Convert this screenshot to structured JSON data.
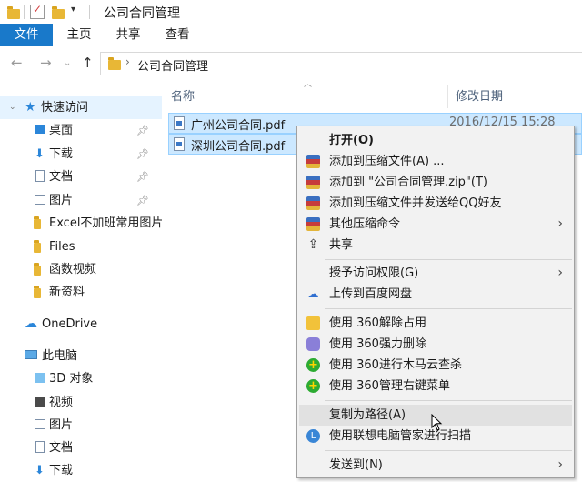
{
  "window": {
    "title": "公司合同管理"
  },
  "ribbon": {
    "tabs": [
      "文件",
      "主页",
      "共享",
      "查看"
    ]
  },
  "address": {
    "path": "公司合同管理"
  },
  "sidebar": {
    "quick_access": "快速访问",
    "items": [
      {
        "label": "桌面",
        "pinned": true
      },
      {
        "label": "下载",
        "pinned": true
      },
      {
        "label": "文档",
        "pinned": true
      },
      {
        "label": "图片",
        "pinned": true
      },
      {
        "label": "Excel不加班常用图片",
        "pinned": false
      },
      {
        "label": "Files",
        "pinned": false
      },
      {
        "label": "函数视频",
        "pinned": false
      },
      {
        "label": "新资料",
        "pinned": false
      }
    ],
    "onedrive": "OneDrive",
    "this_pc": "此电脑",
    "pc_items": [
      "3D 对象",
      "视频",
      "图片",
      "文档",
      "下载"
    ]
  },
  "columns": {
    "name": "名称",
    "date": "修改日期"
  },
  "files": [
    {
      "name": "广州公司合同.pdf",
      "date": "2016/12/15 15:28"
    },
    {
      "name": "深圳公司合同.pdf",
      "date": ""
    }
  ],
  "context_menu": {
    "items": [
      {
        "label": "打开(O)",
        "icon": "none",
        "bold": true
      },
      {
        "label": "添加到压缩文件(A) ...",
        "icon": "archive-icon"
      },
      {
        "label": "添加到 \"公司合同管理.zip\"(T)",
        "icon": "archive-icon"
      },
      {
        "label": "添加到压缩文件并发送给QQ好友",
        "icon": "archive-icon"
      },
      {
        "label": "其他压缩命令",
        "icon": "archive-icon",
        "submenu": true
      },
      {
        "label": "共享",
        "icon": "share-icon"
      },
      {
        "label": "授予访问权限(G)",
        "icon": "none",
        "submenu": true
      },
      {
        "label": "上传到百度网盘",
        "icon": "baidu-cloud-icon"
      },
      {
        "label": "使用 360解除占用",
        "icon": "360-unlock-icon"
      },
      {
        "label": "使用 360强力删除",
        "icon": "360-delete-icon"
      },
      {
        "label": "使用 360进行木马云查杀",
        "icon": "360-scan-icon"
      },
      {
        "label": "使用 360管理右键菜单",
        "icon": "360-menu-icon"
      },
      {
        "label": "复制为路径(A)",
        "icon": "none",
        "hover": true
      },
      {
        "label": "使用联想电脑管家进行扫描",
        "icon": "lenovo-icon"
      },
      {
        "label": "发送到(N)",
        "icon": "none",
        "submenu": true
      }
    ]
  },
  "colors": {
    "accent": "#1979ca",
    "selection": "#cce8ff",
    "folder": "#e8b736"
  }
}
